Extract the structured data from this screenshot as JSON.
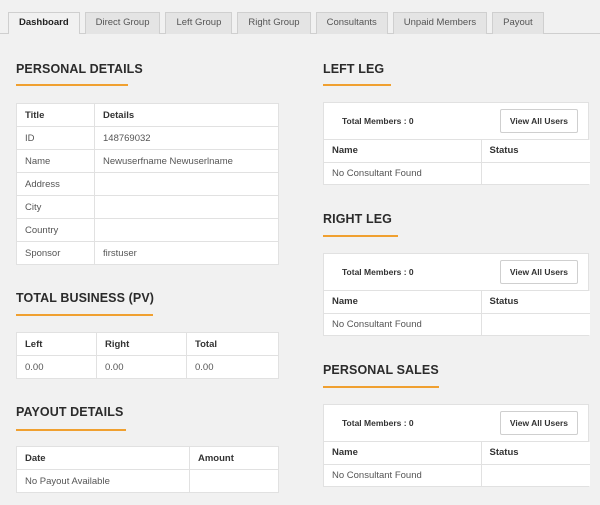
{
  "tabs": [
    {
      "label": "Dashboard",
      "active": true
    },
    {
      "label": "Direct Group"
    },
    {
      "label": "Left Group"
    },
    {
      "label": "Right Group"
    },
    {
      "label": "Consultants"
    },
    {
      "label": "Unpaid Members"
    },
    {
      "label": "Payout"
    }
  ],
  "personal_details": {
    "title": "PERSONAL DETAILS",
    "headers": [
      "Title",
      "Details"
    ],
    "rows": [
      [
        "ID",
        "148769032"
      ],
      [
        "Name",
        "Newuserfname Newuserlname"
      ],
      [
        "Address",
        ""
      ],
      [
        "City",
        ""
      ],
      [
        "Country",
        ""
      ],
      [
        "Sponsor",
        "firstuser"
      ]
    ]
  },
  "total_business": {
    "title": "TOTAL BUSINESS (PV)",
    "headers": [
      "Left",
      "Right",
      "Total"
    ],
    "row": [
      "0.00",
      "0.00",
      "0.00"
    ]
  },
  "payout_details": {
    "title": "PAYOUT DETAILS",
    "headers": [
      "Date",
      "Amount"
    ],
    "empty": "No Payout Available"
  },
  "left_leg": {
    "title": "LEFT LEG",
    "count": "Total Members : 0",
    "button": "View All Users",
    "headers": [
      "Name",
      "Status"
    ],
    "empty": "No Consultant Found"
  },
  "right_leg": {
    "title": "RIGHT LEG",
    "count": "Total Members : 0",
    "button": "View All Users",
    "headers": [
      "Name",
      "Status"
    ],
    "empty": "No Consultant Found"
  },
  "personal_sales": {
    "title": "PERSONAL SALES",
    "count": "Total Members : 0",
    "button": "View All Users",
    "headers": [
      "Name",
      "Status"
    ],
    "empty": "No Consultant Found"
  },
  "colors": {
    "accent": "#f0a030",
    "background": "#f1f1f1"
  }
}
